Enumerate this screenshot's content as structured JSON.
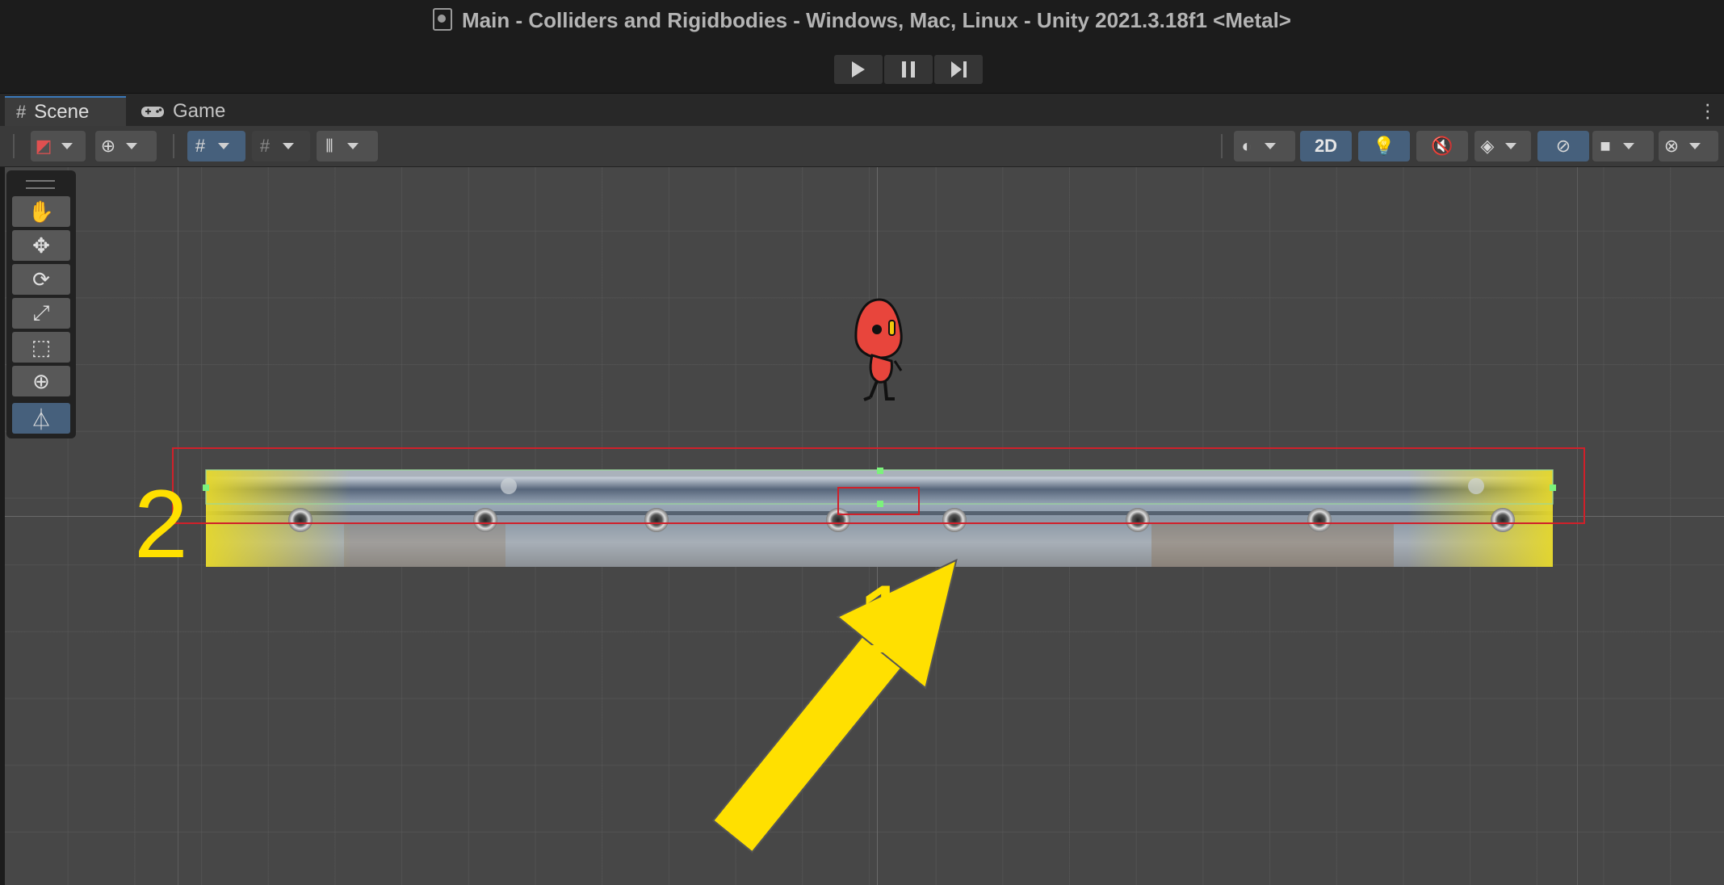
{
  "window": {
    "title": "Main - Colliders and Rigidbodies - Windows, Mac, Linux - Unity 2021.3.18f1 <Metal>"
  },
  "playbar": {
    "play": "play-icon",
    "pause": "pause-icon",
    "step": "step-icon"
  },
  "tabs": [
    {
      "label": "Scene",
      "icon": "grid-icon"
    },
    {
      "label": "Game",
      "icon": "gamepad-icon"
    }
  ],
  "toolbar": {
    "mode_2d": "2D"
  },
  "tools": [
    "hand-tool",
    "move-tool",
    "rotate-tool",
    "scale-tool",
    "rect-tool",
    "transform-tool",
    "edit-collider-tool"
  ],
  "annotations": {
    "label1": "1",
    "label2": "2"
  },
  "colors": {
    "accent": "#46607c",
    "annotation": "#ffe000",
    "collider": "#d0202a",
    "handle": "#7cf27c"
  }
}
